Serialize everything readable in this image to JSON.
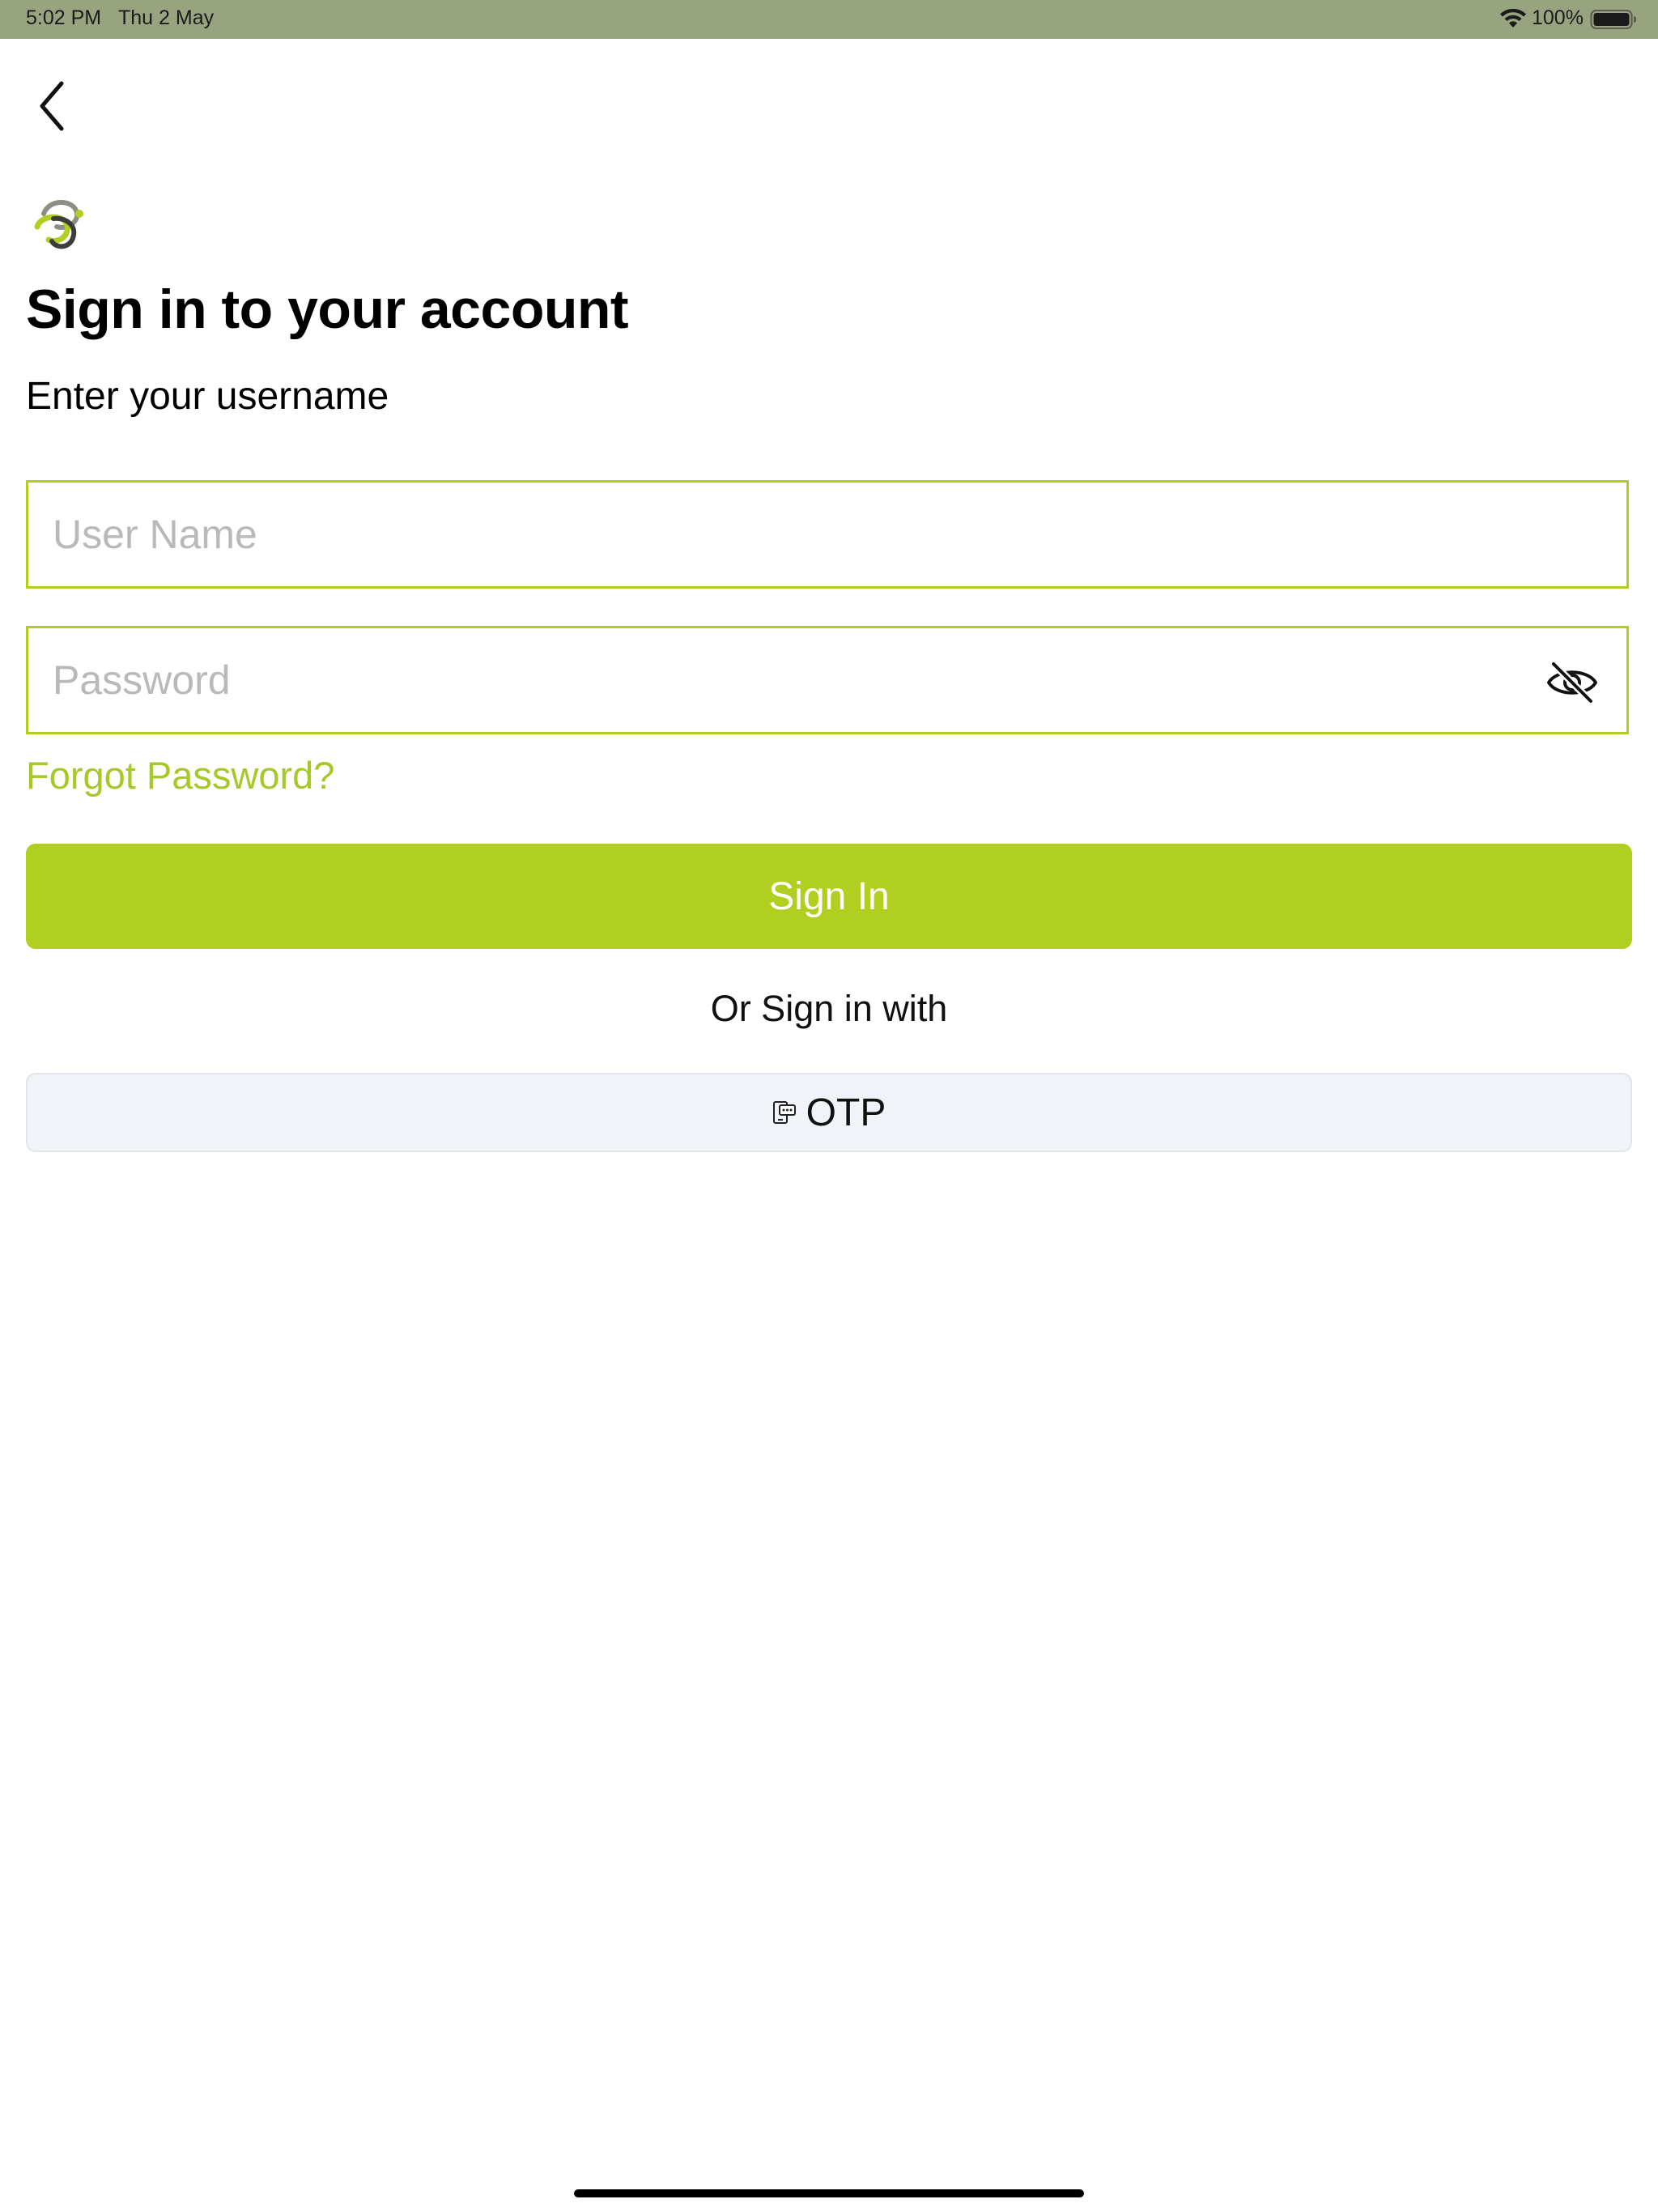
{
  "status_bar": {
    "time": "5:02 PM",
    "date": "Thu 2 May",
    "battery": "100%",
    "icons": [
      "wifi-icon",
      "battery-icon"
    ]
  },
  "navigation": {
    "back_icon": "chevron-left-icon"
  },
  "logo": {
    "icon": "brand-swirl-logo"
  },
  "header": {
    "title": "Sign in to your account",
    "subtitle": "Enter your username"
  },
  "form": {
    "username_placeholder": "User Name",
    "username_value": "",
    "password_placeholder": "Password",
    "password_value": "",
    "password_toggle_icon": "eye-off-icon",
    "forgot_label": "Forgot Password?",
    "sign_in_label": "Sign In"
  },
  "alternate": {
    "label": "Or Sign in with",
    "otp_label": "OTP",
    "otp_icon": "phone-message-icon"
  },
  "colors": {
    "accent": "#b1cf20",
    "link": "#a6c829",
    "status_bar": "#98a37f",
    "otp_button_bg": "#f0f3f7"
  }
}
